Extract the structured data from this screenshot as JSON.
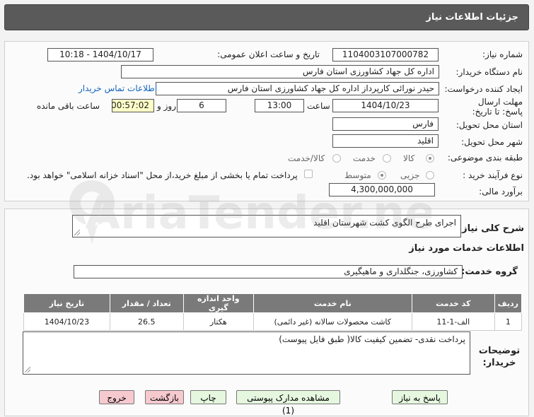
{
  "header": {
    "title": "جزئیات اطلاعات نیاز"
  },
  "form": {
    "need_number_label": "شماره نیاز:",
    "need_number": "1104003107000782",
    "announce_label": "تاریخ و ساعت اعلان عمومی:",
    "announce_value": "1404/10/17 - 10:18",
    "buyer_org_label": "نام دستگاه خریدار:",
    "buyer_org": "اداره کل جهاد کشاورزی استان فارس",
    "creator_label": "ایجاد کننده درخواست:",
    "creator": "حیدر نورائی کارپرداز اداره کل جهاد کشاورزی استان فارس",
    "contact_link": "اطلاعات تماس خریدار",
    "deadline_label": "مهلت ارسال پاسخ: تا تاریخ:",
    "deadline_date": "1404/10/23",
    "time_label": "ساعت",
    "deadline_time": "13:00",
    "days": "6",
    "days_label": "روز و",
    "remaining_time": "00:57:02",
    "remaining_label": "ساعت باقی مانده",
    "province_label": "استان محل تحویل:",
    "province": "فارس",
    "city_label": "شهر محل تحویل:",
    "city": "اقلید",
    "category_label": "طبقه بندی موضوعی:",
    "category_options": [
      "کالا",
      "خدمت",
      "کالا/خدمت"
    ],
    "process_label": "نوع فرآیند خرید :",
    "process_options": [
      "جزیی",
      "متوسط"
    ],
    "payment_note": "پرداخت تمام یا بخشی از مبلغ خرید،از محل \"اسناد خزانه اسلامی\" خواهد بود.",
    "budget_label": "برآورد مالی:",
    "budget": "4,300,000,000"
  },
  "description": {
    "label": "شرح کلی نیاز:",
    "text": "اجرای طرح الگوی کشت شهرستان اقلید"
  },
  "services": {
    "section_title": "اطلاعات خدمات مورد نیاز",
    "group_label": "گروه خدمت:",
    "group_value": "کشاورزی، جنگلداری و ماهیگیری",
    "columns": [
      "ردیف",
      "کد خدمت",
      "نام خدمت",
      "واحد اندازه گیری",
      "تعداد / مقدار",
      "تاریخ نیاز"
    ],
    "rows": [
      [
        "1",
        "الف-1-11",
        "کاشت محصولات سالانه (غیر دائمی)",
        "هکتار",
        "26.5",
        "1404/10/23"
      ]
    ]
  },
  "buyer_notes": {
    "label": "توضیحات خریدار:",
    "text": "پرداخت نقدی- تضمین کیفیت کالا( طبق فایل پیوست)"
  },
  "buttons": {
    "reply": "پاسخ به نیاز",
    "view_docs": "مشاهده مدارک پیوستی (1)",
    "print": "چاپ",
    "back": "بازگشت",
    "exit": "خروج"
  },
  "watermark": {
    "text": "AriaTender.neT"
  }
}
